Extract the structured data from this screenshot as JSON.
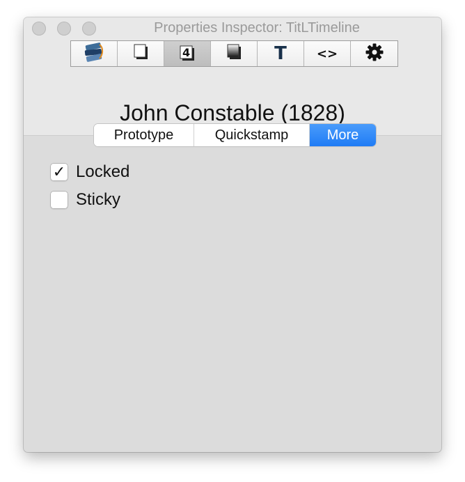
{
  "window": {
    "title": "Properties Inspector: TitLTimeline"
  },
  "toolbar": {
    "buttons": [
      {
        "icon": "layers-icon",
        "active": false
      },
      {
        "icon": "page-shadow-icon",
        "active": false
      },
      {
        "icon": "badge-number-icon",
        "label": "4",
        "active": true
      },
      {
        "icon": "gradient-box-icon",
        "active": false
      },
      {
        "icon": "text-icon",
        "label": "T",
        "active": false
      },
      {
        "icon": "code-icon",
        "label": "<>",
        "active": false
      },
      {
        "icon": "gear-icon",
        "active": false
      }
    ]
  },
  "item": {
    "name": "John Constable (1828)"
  },
  "tabs": [
    {
      "label": "Prototype",
      "selected": false
    },
    {
      "label": "Quickstamp",
      "selected": false
    },
    {
      "label": "More",
      "selected": true
    }
  ],
  "options": [
    {
      "label": "Locked",
      "checked": true,
      "check_glyph": "✓"
    },
    {
      "label": "Sticky",
      "checked": false
    }
  ],
  "colors": {
    "accent": "#1f7cf5",
    "window_bg": "#dcdcdc",
    "header_bg": "#e8e8e8"
  }
}
